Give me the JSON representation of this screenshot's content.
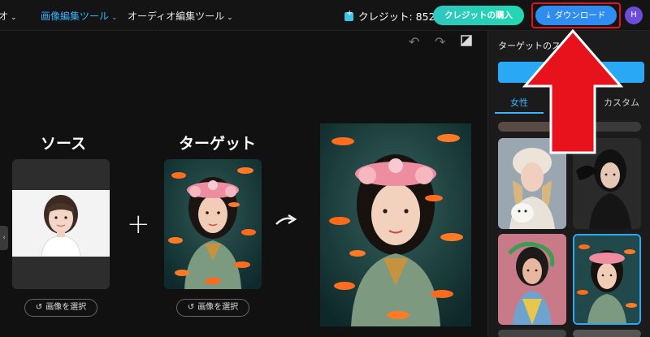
{
  "nav": {
    "item1": "オーディオ",
    "item1_visible": "オ",
    "image_tools": "画像編集ツール",
    "audio_tools": "オーディオ編集ツール"
  },
  "header": {
    "credits_label": "クレジット: 852",
    "buy_label": "クレジットの購入",
    "download_label": "ダウンロード",
    "avatar_initial": "H"
  },
  "canvas": {
    "source_title": "ソース",
    "target_title": "ターゲット",
    "select_image_label": "画像を選択"
  },
  "panel": {
    "title": "ターゲットのスタ",
    "tabs": [
      "女性",
      "カスタム"
    ]
  },
  "colors": {
    "accent": "#39b5ff",
    "download_button": "#2f8cf0",
    "buy_button": "#2ec7c0",
    "highlight": "#e8121c",
    "avatar": "#6c4cdb"
  },
  "icons": {
    "undo": "undo-icon",
    "redo": "redo-icon",
    "erase": "eraser-icon",
    "download": "download-icon",
    "credit": "credit-gem-icon",
    "reselect": "refresh-icon"
  }
}
